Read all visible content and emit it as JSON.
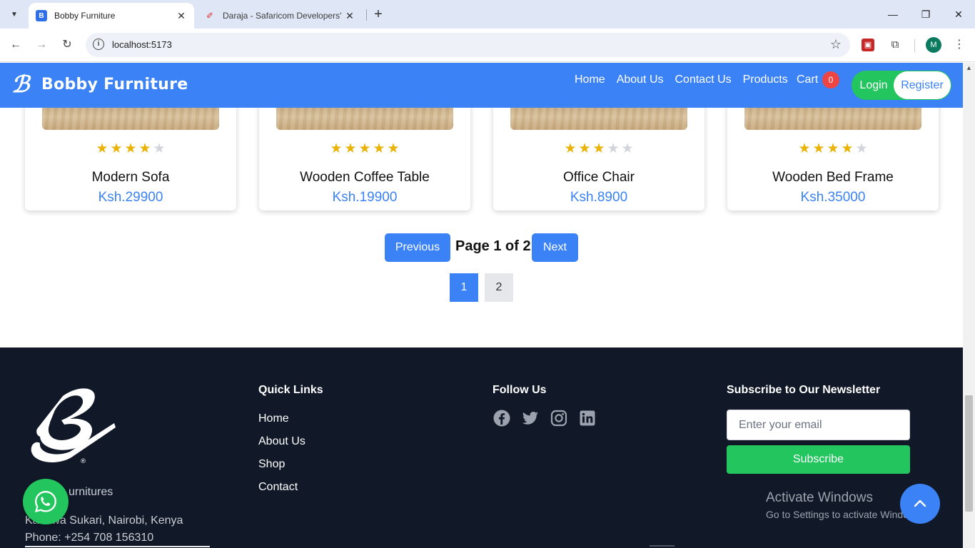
{
  "browser": {
    "tabs": [
      {
        "title": "Bobby Furniture",
        "active": true
      },
      {
        "title": "Daraja - Safaricom Developers'",
        "active": false
      }
    ],
    "url": "localhost:5173",
    "profile_initial": "M"
  },
  "navbar": {
    "brand": "Bobby Furniture",
    "links": [
      "Home",
      "About Us",
      "Contact Us",
      "Products"
    ],
    "cart_label": "Cart",
    "cart_count": "0",
    "login_label": "Login",
    "register_label": "Register",
    "colors": {
      "bar": "#3b82f6",
      "auth_green": "#22c55e",
      "badge": "#ef4444"
    }
  },
  "products": [
    {
      "name": "Modern Sofa",
      "price": "Ksh.29900",
      "rating": 4
    },
    {
      "name": "Wooden Coffee Table",
      "price": "Ksh.19900",
      "rating": 5
    },
    {
      "name": "Office Chair",
      "price": "Ksh.8900",
      "rating": 3
    },
    {
      "name": "Wooden Bed Frame",
      "price": "Ksh.35000",
      "rating": 4
    }
  ],
  "pagination": {
    "previous_label": "Previous",
    "next_label": "Next",
    "page_info": "Page 1 of 2",
    "pages": [
      "1",
      "2"
    ],
    "current_page": 1
  },
  "footer": {
    "brand_text": "urnitures",
    "address": "Kahawa Sukari, Nairobi, Kenya",
    "phone": "Phone: +254 708 156310",
    "quick_links_heading": "Quick Links",
    "quick_links": [
      "Home",
      "About Us",
      "Shop",
      "Contact"
    ],
    "follow_heading": "Follow Us",
    "social_icons": [
      "facebook-icon",
      "twitter-icon",
      "instagram-icon",
      "linkedin-icon"
    ],
    "newsletter_heading": "Subscribe to Our Newsletter",
    "email_placeholder": "Enter your email",
    "subscribe_label": "Subscribe"
  },
  "watermark": {
    "line1": "Activate Windows",
    "line2": "Go to Settings to activate Windows."
  }
}
